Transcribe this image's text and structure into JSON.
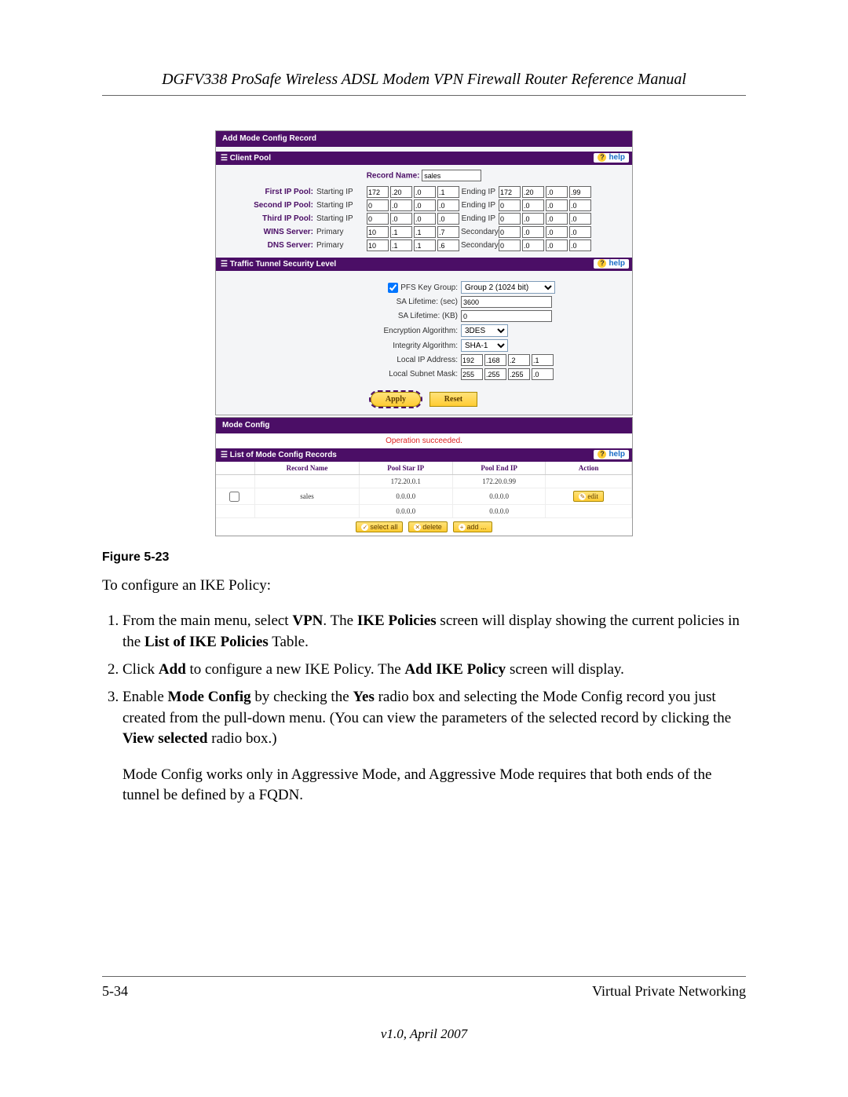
{
  "header": "DGFV338 ProSafe Wireless ADSL Modem VPN Firewall Router Reference Manual",
  "p1": {
    "tab": "Add Mode Config Record",
    "s1": "Client Pool",
    "help": "help",
    "recname_lbl": "Record Name:",
    "recname": "sales",
    "rows": [
      {
        "l": "First IP Pool:",
        "a": "Starting IP",
        "v1": [
          "172",
          ".20",
          ".0",
          ".1"
        ],
        "b": "Ending IP",
        "v2": [
          "172",
          ".20",
          ".0",
          ".99"
        ]
      },
      {
        "l": "Second IP Pool:",
        "a": "Starting IP",
        "v1": [
          "0",
          ".0",
          ".0",
          ".0"
        ],
        "b": "Ending IP",
        "v2": [
          "0",
          ".0",
          ".0",
          ".0"
        ]
      },
      {
        "l": "Third IP Pool:",
        "a": "Starting IP",
        "v1": [
          "0",
          ".0",
          ".0",
          ".0"
        ],
        "b": "Ending IP",
        "v2": [
          "0",
          ".0",
          ".0",
          ".0"
        ]
      },
      {
        "l": "WINS Server:",
        "a": "Primary",
        "v1": [
          "10",
          ".1",
          ".1",
          ".7"
        ],
        "b": "Secondary",
        "v2": [
          "0",
          ".0",
          ".0",
          ".0"
        ]
      },
      {
        "l": "DNS Server:",
        "a": "Primary",
        "v1": [
          "10",
          ".1",
          ".1",
          ".6"
        ],
        "b": "Secondary",
        "v2": [
          "0",
          ".0",
          ".0",
          ".0"
        ]
      }
    ],
    "s2": "Traffic Tunnel Security Level",
    "pfs_lbl": "PFS Key Group:",
    "pfs": "Group 2 (1024 bit)",
    "sa1_lbl": "SA Lifetime: (sec)",
    "sa1": "3600",
    "sa2_lbl": "SA Lifetime: (KB)",
    "sa2": "0",
    "enc_lbl": "Encryption Algorithm:",
    "enc": "3DES",
    "int_lbl": "Integrity Algorithm:",
    "int": "SHA-1",
    "lip_lbl": "Local IP Address:",
    "lip": [
      "192",
      ".168",
      ".2",
      ".1"
    ],
    "lsm_lbl": "Local Subnet Mask:",
    "lsm": [
      "255",
      ".255",
      ".255",
      ".0"
    ],
    "apply": "Apply",
    "reset": "Reset"
  },
  "p2": {
    "tab": "Mode Config",
    "status": "Operation succeeded.",
    "sect": "List of Mode Config Records",
    "th": [
      "",
      "Record Name",
      "Pool Star IP",
      "Pool End IP",
      "Action"
    ],
    "r": [
      [
        "",
        "",
        "172.20.0.1",
        "172.20.0.99",
        ""
      ],
      [
        "",
        "sales",
        "0.0.0.0",
        "0.0.0.0",
        "edit"
      ],
      [
        "",
        "",
        "0.0.0.0",
        "0.0.0.0",
        ""
      ]
    ],
    "btns": {
      "sa": "select all",
      "del": "delete",
      "add": "add ..."
    }
  },
  "figcap": "Figure 5-23",
  "intro": "To configure an IKE Policy:",
  "steps": [
    "From the main menu, select <b>VPN</b>. The <b>IKE Policies</b> screen will display showing the current policies in the <b>List of IKE Policies</b> Table.",
    "Click <b>Add</b> to configure a new IKE Policy. The <b>Add IKE Policy</b> screen will display.",
    "Enable <b>Mode Config</b> by checking the <b>Yes</b> radio box and selecting the Mode Config record you just created from the pull-down menu. (You can view the parameters of the selected record by clicking the <b>View selected</b> radio box.)"
  ],
  "note": "Mode Config works only in Aggressive Mode, and Aggressive Mode requires that both ends of the tunnel be defined by a FQDN.",
  "footer": {
    "page": "5-34",
    "section": "Virtual Private Networking",
    "version": "v1.0, April 2007"
  }
}
